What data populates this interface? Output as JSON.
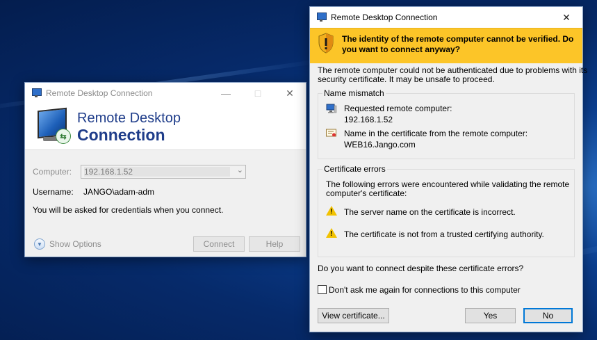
{
  "left_window": {
    "title": "Remote Desktop Connection",
    "brand_line1": "Remote Desktop",
    "brand_line2": "Connection",
    "computer_label": "Computer:",
    "computer_value": "192.168.1.52",
    "username_label": "Username:",
    "username_value": "JANGO\\adam-adm",
    "credentials_note": "You will be asked for credentials when you connect.",
    "show_options": "Show Options",
    "connect": "Connect",
    "help": "Help"
  },
  "right_window": {
    "title": "Remote Desktop Connection",
    "warning": "The identity of the remote computer cannot be verified. Do you want to connect anyway?",
    "intro_line1": "The remote computer could not be authenticated due to problems with its",
    "intro_line2": "security certificate. It may be unsafe to proceed.",
    "name_mismatch_title": "Name mismatch",
    "requested_label": "Requested remote computer:",
    "requested_value": "192.168.1.52",
    "cert_name_label": "Name in the certificate from the remote computer:",
    "cert_name_value": "WEB16.Jango.com",
    "cert_errors_title": "Certificate errors",
    "cert_errors_intro1": "The following errors were encountered while validating the remote",
    "cert_errors_intro2": "computer's certificate:",
    "error1": "The server name on the certificate is incorrect.",
    "error2": "The certificate is not from a trusted certifying authority.",
    "question": "Do you want to connect despite these certificate errors?",
    "dont_ask": "Don't ask me again for connections to this computer",
    "view_certificate": "View certificate...",
    "yes": "Yes",
    "no": "No"
  },
  "icons": [
    "app-icon",
    "minimize-icon",
    "maximize-icon",
    "close-icon",
    "shield-warning-icon",
    "computer-icon",
    "certificate-icon",
    "warning-icon",
    "chevron-down-icon"
  ]
}
